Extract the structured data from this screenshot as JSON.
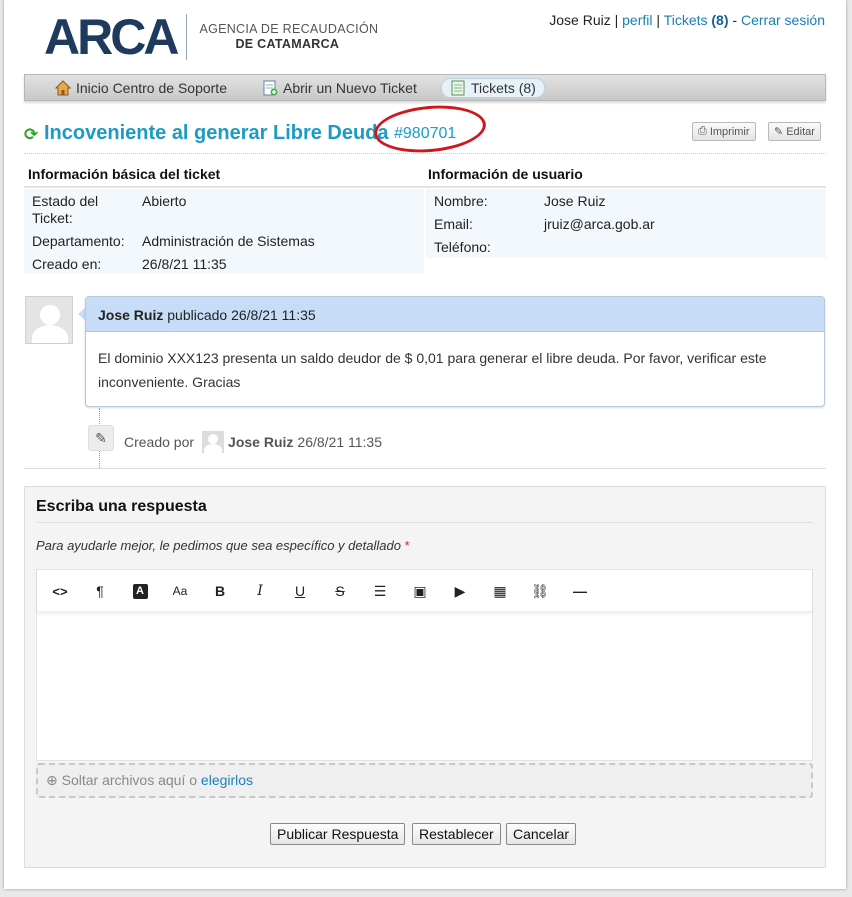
{
  "header": {
    "logo_word": "ARCA",
    "agency_line1": "AGENCIA DE RECAUDACIÓN",
    "agency_line2": "DE CATAMARCA",
    "user_name": "Jose Ruiz",
    "sep1": "|",
    "profile_link": "perfil",
    "sep2": "|",
    "tickets_link": "Tickets",
    "tickets_count": "(8)",
    "sep3": "-",
    "logout_link": "Cerrar sesión"
  },
  "nav": {
    "items": [
      {
        "label": "Inicio Centro de Soporte",
        "icon": "home-icon"
      },
      {
        "label": "Abrir un Nuevo Ticket",
        "icon": "new-ticket-icon"
      },
      {
        "label": "Tickets (8)",
        "icon": "tickets-icon"
      }
    ]
  },
  "ticket": {
    "title": "Incoveniente al generar Libre Deuda",
    "number": "#980701",
    "print_label": "Imprimir",
    "edit_label": "Editar"
  },
  "basic_info": {
    "heading": "Información básica del ticket",
    "rows": [
      {
        "label": "Estado del Ticket:",
        "value": "Abierto"
      },
      {
        "label": "Departamento:",
        "value": "Administración de Sistemas"
      },
      {
        "label": "Creado en:",
        "value": "26/8/21 11:35"
      }
    ]
  },
  "user_info": {
    "heading": "Información de usuario",
    "rows": [
      {
        "label": "Nombre:",
        "value": "Jose Ruiz"
      },
      {
        "label": "Email:",
        "value": "jruiz@arca.gob.ar"
      },
      {
        "label": "Teléfono:",
        "value": ""
      }
    ]
  },
  "message": {
    "author": "Jose Ruiz",
    "meta": "publicado 26/8/21 11:35",
    "body": "El dominio XXX123 presenta un saldo deudor de $ 0,01 para generar el libre deuda. Por favor, verificar este inconveniente. Gracias"
  },
  "event": {
    "prefix": "Creado por",
    "author": "Jose Ruiz",
    "time": "26/8/21 11:35"
  },
  "reply": {
    "title": "Escriba una respuesta",
    "hint": "Para ayudarle mejor, le pedimos que sea específico y detallado",
    "required_mark": "*",
    "toolbar": [
      {
        "name": "code-icon",
        "glyph": "<>"
      },
      {
        "name": "paragraph-icon",
        "glyph": "¶"
      },
      {
        "name": "text-color-icon",
        "glyph": "A"
      },
      {
        "name": "font-size-icon",
        "glyph": "Aa"
      },
      {
        "name": "bold-icon",
        "glyph": "B"
      },
      {
        "name": "italic-icon",
        "glyph": "I"
      },
      {
        "name": "underline-icon",
        "glyph": "U"
      },
      {
        "name": "strikethrough-icon",
        "glyph": "S"
      },
      {
        "name": "list-icon",
        "glyph": "☰"
      },
      {
        "name": "image-icon",
        "glyph": "▣"
      },
      {
        "name": "video-icon",
        "glyph": "▶"
      },
      {
        "name": "table-icon",
        "glyph": "▦"
      },
      {
        "name": "link-icon",
        "glyph": "⛓"
      },
      {
        "name": "horizontal-rule-icon",
        "glyph": "—"
      }
    ],
    "drop_text": "Soltar archivos aquí o",
    "drop_link": "elegirlos",
    "submit_label": "Publicar Respuesta",
    "reset_label": "Restablecer",
    "cancel_label": "Cancelar"
  }
}
